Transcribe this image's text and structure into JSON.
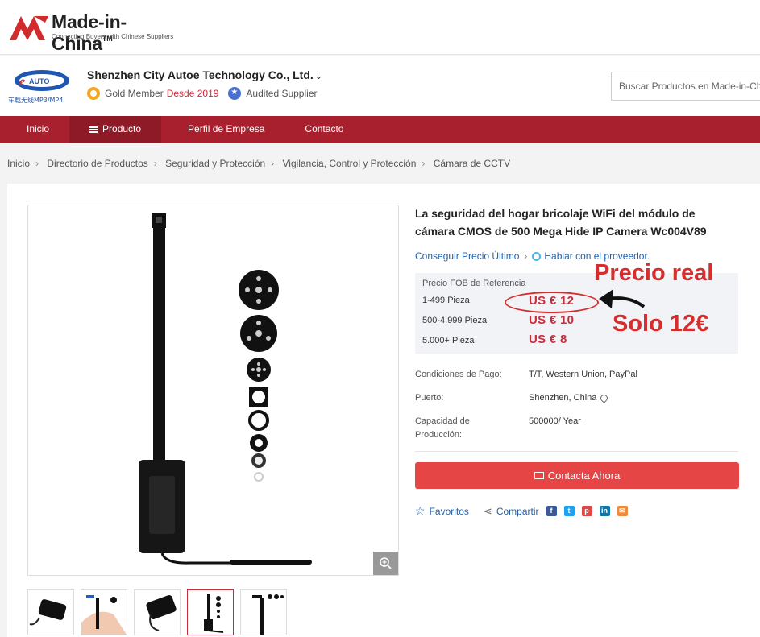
{
  "brand": {
    "name": "Made-in-China",
    "tm": "TM",
    "tagline": "Connecting Buyers with Chinese Suppliers"
  },
  "supplier": {
    "logo_text": "AUTO",
    "logo_caption": "车载无线MP3/MP4",
    "name": "Shenzhen City Autoe Technology Co., Ltd.",
    "member": "Gold Member",
    "since": "Desde 2019",
    "audited": "Audited Supplier"
  },
  "search": {
    "placeholder": "Buscar Productos en Made-in-China"
  },
  "nav": [
    "Inicio",
    "Producto",
    "Perfil de Empresa",
    "Contacto"
  ],
  "breadcrumb": [
    "Inicio",
    "Directorio de Productos",
    "Seguridad y Protección",
    "Vigilancia, Control y Protección",
    "Cámara de CCTV"
  ],
  "product": {
    "title": "La seguridad del hogar bricolaje WiFi del módulo de cámara CMOS de 500 Mega Hide IP Camera Wc004V89",
    "get_price": "Conseguir Precio Último",
    "chat": "Hablar con el proveedor.",
    "fob_label": "Precio FOB de Referencia",
    "tiers": [
      {
        "qty": "1-499 Pieza",
        "price": "US € 12"
      },
      {
        "qty": "500-4.999 Pieza",
        "price": "US € 10"
      },
      {
        "qty": "5.000+ Pieza",
        "price": "US €  8"
      }
    ],
    "annotation_1": "Precio real",
    "annotation_2": "Solo 12€",
    "specs": [
      {
        "key": "Condiciones de Pago:",
        "value": "T/T, Western Union, PayPal"
      },
      {
        "key": "Puerto:",
        "value": "Shenzhen, China"
      },
      {
        "key": "Capacidad de Producción:",
        "value": "500000/ Year"
      }
    ],
    "contact_button": "Contacta Ahora",
    "favorites": "Favoritos",
    "share": "Compartir"
  },
  "colors": {
    "nav": "#a8202e",
    "price": "#c82d3a",
    "button": "#e64545",
    "link": "#2561a9"
  }
}
